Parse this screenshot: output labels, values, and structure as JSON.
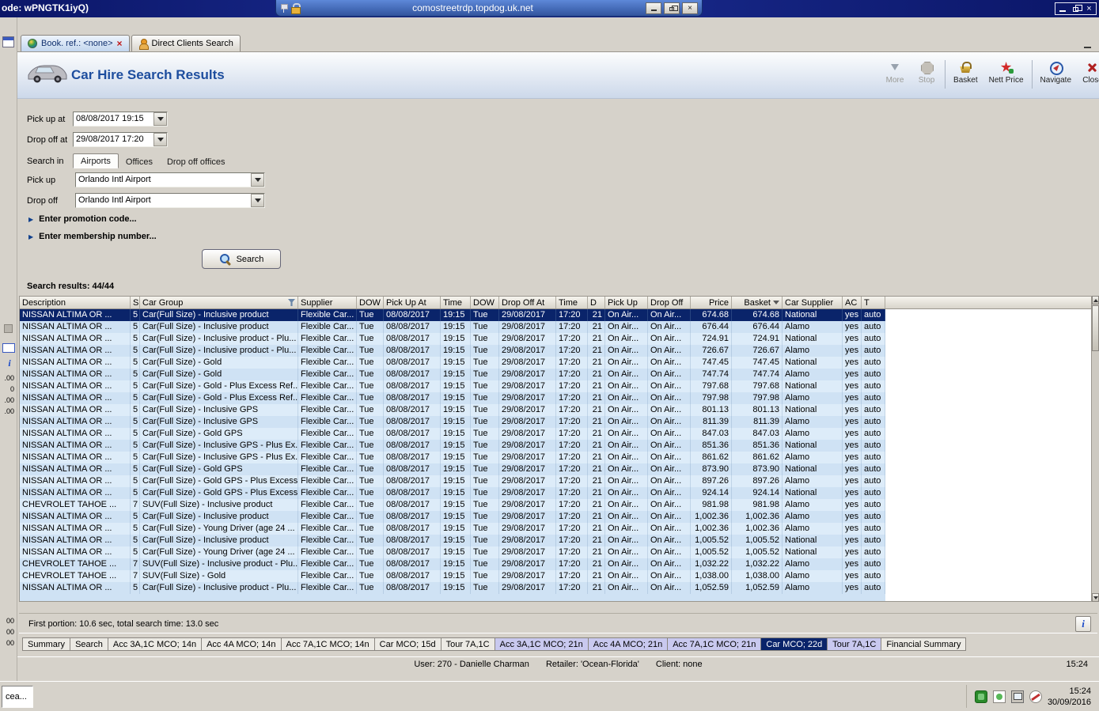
{
  "window": {
    "title": "ode: wPNGTK1iyQ)"
  },
  "rdp": {
    "host": "comostreetrdp.topdog.uk.net"
  },
  "doc_tabs": [
    {
      "label": "Book. ref.: <none>",
      "active": true,
      "closable": true
    },
    {
      "label": "Direct Clients Search",
      "active": false,
      "closable": false
    }
  ],
  "header": {
    "title": "Car Hire Search Results",
    "toolbar": [
      {
        "label": "More",
        "icon": "more-arrow-icon",
        "disabled": true,
        "sep_after": false
      },
      {
        "label": "Stop",
        "icon": "stop-icon",
        "disabled": true,
        "sep_after": true
      },
      {
        "label": "Basket",
        "icon": "basket-icon",
        "disabled": false,
        "sep_after": false
      },
      {
        "label": "Nett Price",
        "icon": "nett-price-icon",
        "disabled": false,
        "sep_after": true
      },
      {
        "label": "Navigate",
        "icon": "navigate-icon",
        "disabled": false,
        "sep_after": false
      },
      {
        "label": "Close",
        "icon": "close-tool-icon",
        "disabled": false,
        "sep_after": false
      }
    ]
  },
  "form": {
    "pickup_at": {
      "label": "Pick up at",
      "value": "08/08/2017 19:15"
    },
    "dropoff_at": {
      "label": "Drop off at",
      "value": "29/08/2017 17:20"
    },
    "search_in": {
      "label": "Search in",
      "tabs": [
        "Airports",
        "Offices",
        "Drop off offices"
      ],
      "active": 0
    },
    "pickup": {
      "label": "Pick up",
      "value": "Orlando Intl Airport"
    },
    "dropoff": {
      "label": "Drop off",
      "value": "Orlando Intl Airport"
    },
    "promo_toggle": "Enter promotion code...",
    "membership_toggle": "Enter membership number...",
    "search_button": "Search"
  },
  "results": {
    "summary": "Search results: 44/44",
    "columns": [
      "Description",
      "S",
      "Car Group",
      "Supplier",
      "DOW",
      "Pick Up At",
      "Time",
      "DOW",
      "Drop Off At",
      "Time",
      "D",
      "Pick Up",
      "Drop Off",
      "Price",
      "Basket",
      "Car Supplier",
      "AC",
      "T"
    ],
    "common": {
      "supplier": "Flexible Car...",
      "dow1": "Tue",
      "pu_date": "08/08/2017",
      "pu_time": "19:15",
      "dow2": "Tue",
      "do_date": "29/08/2017",
      "do_time": "17:20",
      "days": "21",
      "pu_loc": "On Air...",
      "do_loc": "On Air...",
      "ac": "yes",
      "t": "auto"
    },
    "rows": [
      {
        "desc": "NISSAN ALTIMA OR ...",
        "s": "5",
        "group": "Car(Full Size) - Inclusive product",
        "price": "674.68",
        "basket": "674.68",
        "car_supplier": "National",
        "selected": true
      },
      {
        "desc": "NISSAN ALTIMA OR ...",
        "s": "5",
        "group": "Car(Full Size) - Inclusive product",
        "price": "676.44",
        "basket": "676.44",
        "car_supplier": "Alamo"
      },
      {
        "desc": "NISSAN ALTIMA OR ...",
        "s": "5",
        "group": "Car(Full Size) - Inclusive product - Plu...",
        "price": "724.91",
        "basket": "724.91",
        "car_supplier": "National"
      },
      {
        "desc": "NISSAN ALTIMA OR ...",
        "s": "5",
        "group": "Car(Full Size) - Inclusive product - Plu...",
        "price": "726.67",
        "basket": "726.67",
        "car_supplier": "Alamo"
      },
      {
        "desc": "NISSAN ALTIMA OR ...",
        "s": "5",
        "group": "Car(Full Size) - Gold",
        "price": "747.45",
        "basket": "747.45",
        "car_supplier": "National"
      },
      {
        "desc": "NISSAN ALTIMA OR ...",
        "s": "5",
        "group": "Car(Full Size) - Gold",
        "price": "747.74",
        "basket": "747.74",
        "car_supplier": "Alamo"
      },
      {
        "desc": "NISSAN ALTIMA OR ...",
        "s": "5",
        "group": "Car(Full Size) - Gold - Plus Excess Ref...",
        "price": "797.68",
        "basket": "797.68",
        "car_supplier": "National"
      },
      {
        "desc": "NISSAN ALTIMA OR ...",
        "s": "5",
        "group": "Car(Full Size) - Gold - Plus Excess Ref...",
        "price": "797.98",
        "basket": "797.98",
        "car_supplier": "Alamo"
      },
      {
        "desc": "NISSAN ALTIMA OR ...",
        "s": "5",
        "group": "Car(Full Size) - Inclusive GPS",
        "price": "801.13",
        "basket": "801.13",
        "car_supplier": "National"
      },
      {
        "desc": "NISSAN ALTIMA OR ...",
        "s": "5",
        "group": "Car(Full Size) - Inclusive GPS",
        "price": "811.39",
        "basket": "811.39",
        "car_supplier": "Alamo"
      },
      {
        "desc": "NISSAN ALTIMA OR ...",
        "s": "5",
        "group": "Car(Full Size) - Gold GPS",
        "price": "847.03",
        "basket": "847.03",
        "car_supplier": "Alamo"
      },
      {
        "desc": "NISSAN ALTIMA OR ...",
        "s": "5",
        "group": "Car(Full Size) - Inclusive GPS - Plus Ex...",
        "price": "851.36",
        "basket": "851.36",
        "car_supplier": "National"
      },
      {
        "desc": "NISSAN ALTIMA OR ...",
        "s": "5",
        "group": "Car(Full Size) - Inclusive GPS - Plus Ex...",
        "price": "861.62",
        "basket": "861.62",
        "car_supplier": "Alamo"
      },
      {
        "desc": "NISSAN ALTIMA OR ...",
        "s": "5",
        "group": "Car(Full Size) - Gold GPS",
        "price": "873.90",
        "basket": "873.90",
        "car_supplier": "National"
      },
      {
        "desc": "NISSAN ALTIMA OR ...",
        "s": "5",
        "group": "Car(Full Size) - Gold GPS - Plus Excess...",
        "price": "897.26",
        "basket": "897.26",
        "car_supplier": "Alamo"
      },
      {
        "desc": "NISSAN ALTIMA OR ...",
        "s": "5",
        "group": "Car(Full Size) - Gold GPS - Plus Excess...",
        "price": "924.14",
        "basket": "924.14",
        "car_supplier": "National"
      },
      {
        "desc": "CHEVROLET TAHOE ...",
        "s": "7",
        "group": "SUV(Full Size) - Inclusive product",
        "price": "981.98",
        "basket": "981.98",
        "car_supplier": "Alamo"
      },
      {
        "desc": "NISSAN ALTIMA OR ...",
        "s": "5",
        "group": "Car(Full Size) - Inclusive product",
        "price": "1,002.36",
        "basket": "1,002.36",
        "car_supplier": "Alamo"
      },
      {
        "desc": "NISSAN ALTIMA OR ...",
        "s": "5",
        "group": "Car(Full Size) - Young Driver (age 24 ...",
        "price": "1,002.36",
        "basket": "1,002.36",
        "car_supplier": "Alamo"
      },
      {
        "desc": "NISSAN ALTIMA OR ...",
        "s": "5",
        "group": "Car(Full Size) - Inclusive product",
        "price": "1,005.52",
        "basket": "1,005.52",
        "car_supplier": "National"
      },
      {
        "desc": "NISSAN ALTIMA OR ...",
        "s": "5",
        "group": "Car(Full Size) - Young Driver (age 24 ...",
        "price": "1,005.52",
        "basket": "1,005.52",
        "car_supplier": "National"
      },
      {
        "desc": "CHEVROLET TAHOE ...",
        "s": "7",
        "group": "SUV(Full Size) - Inclusive product - Plu...",
        "price": "1,032.22",
        "basket": "1,032.22",
        "car_supplier": "Alamo"
      },
      {
        "desc": "CHEVROLET TAHOE ...",
        "s": "7",
        "group": "SUV(Full Size) - Gold",
        "price": "1,038.00",
        "basket": "1,038.00",
        "car_supplier": "Alamo"
      },
      {
        "desc": "NISSAN ALTIMA OR ...",
        "s": "5",
        "group": "Car(Full Size) - Inclusive product - Plu...",
        "price": "1,052.59",
        "basket": "1,052.59",
        "car_supplier": "Alamo"
      }
    ]
  },
  "portion": {
    "text": "First portion: 10.6 sec, total search time: 13.0 sec",
    "info": "i"
  },
  "bottom_tabs": [
    {
      "label": "Summary",
      "variant": "plain"
    },
    {
      "label": "Search",
      "variant": "plain"
    },
    {
      "label": "Acc 3A,1C MCO; 14n",
      "variant": "plain"
    },
    {
      "label": "Acc 4A MCO; 14n",
      "variant": "plain"
    },
    {
      "label": "Acc 7A,1C MCO; 14n",
      "variant": "plain"
    },
    {
      "label": "Car MCO; 15d",
      "variant": "plain"
    },
    {
      "label": "Tour 7A,1C",
      "variant": "plain"
    },
    {
      "label": "Acc 3A,1C MCO; 21n",
      "variant": "purple"
    },
    {
      "label": "Acc 4A MCO; 21n",
      "variant": "purple"
    },
    {
      "label": "Acc 7A,1C MCO; 21n",
      "variant": "purple"
    },
    {
      "label": "Car MCO; 22d",
      "variant": "selected"
    },
    {
      "label": "Tour 7A,1C",
      "variant": "purple"
    },
    {
      "label": "Financial Summary",
      "variant": "plain"
    }
  ],
  "status_bar": {
    "user": "User: 270 - Danielle Charman",
    "retailer": "Retailer: 'Ocean-Florida'",
    "client": "Client: none",
    "time": "15:24"
  },
  "left_panel": {
    "info": "i",
    "mini_values": [
      ".00",
      "0",
      ".00",
      ".00"
    ],
    "bottom_values": [
      "00",
      "00",
      "00"
    ]
  },
  "taskbar": {
    "task": "cea...",
    "time": "15:24",
    "date": "30/09/2016"
  },
  "colors": {
    "accent": "#0a246a",
    "row_a": "#cfe2f4",
    "row_b": "#ddecf9",
    "purple_tab": "#c9c9ef"
  }
}
